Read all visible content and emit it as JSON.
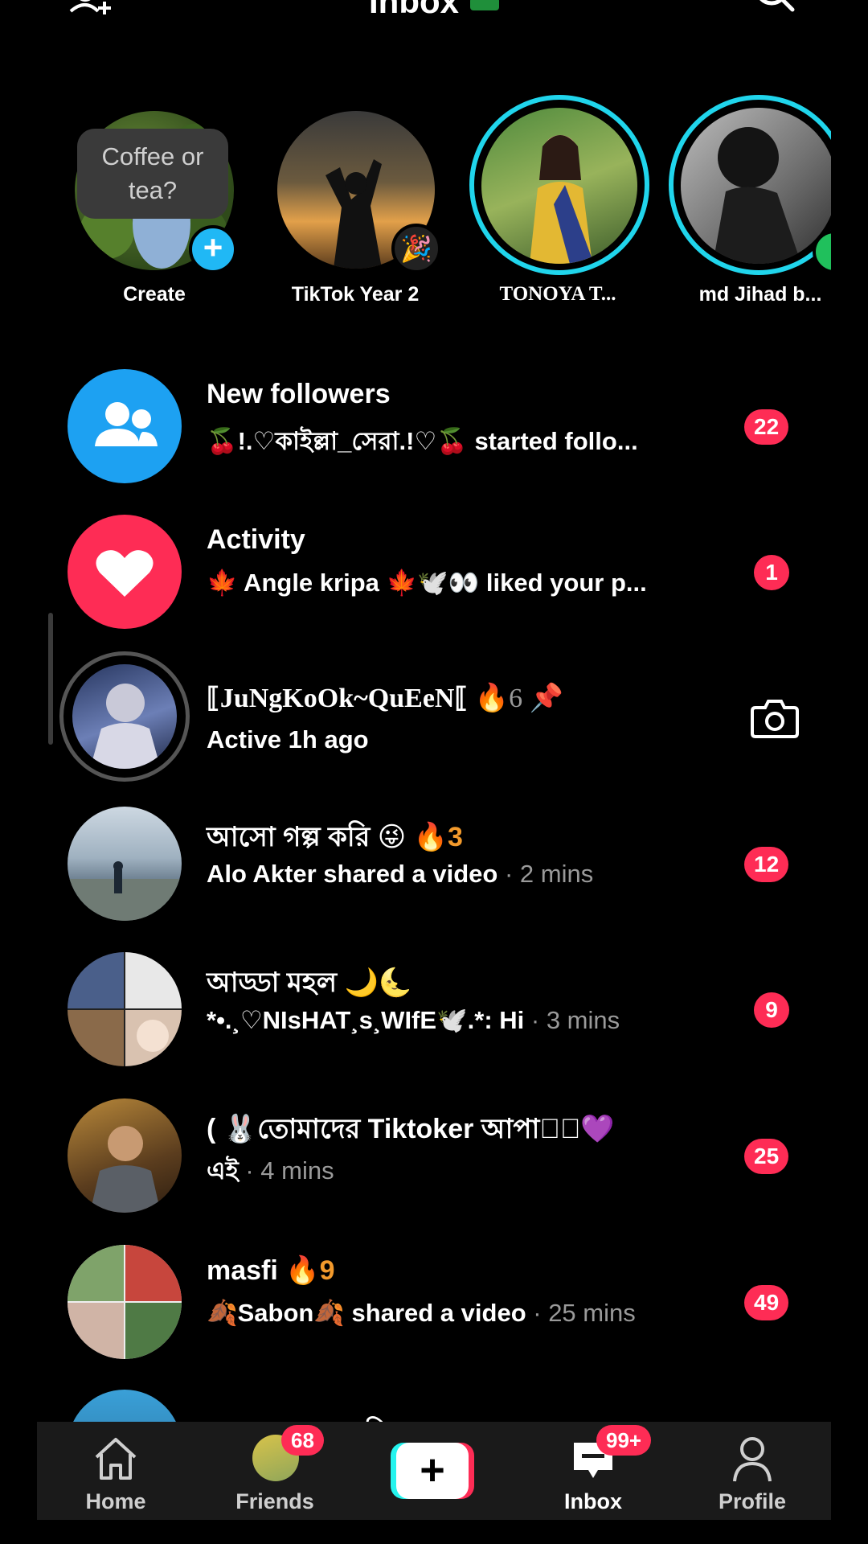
{
  "header": {
    "title": "Inbox"
  },
  "stories": [
    {
      "label": "Create",
      "bubble": "Coffee or tea?"
    },
    {
      "label": "TikTok Year 2"
    },
    {
      "label": "TONOYA T..."
    },
    {
      "label": "md Jihad b..."
    }
  ],
  "rows": [
    {
      "name": "New followers",
      "sub": "🍒!.♡কাইল্লা_সেরা.!♡🍒 started follo...",
      "badge": "22"
    },
    {
      "name": "Activity",
      "sub": "🍁 Angle kripa 🍁🕊️👀 liked your p...",
      "badge": "1"
    },
    {
      "name": "⟦JuNgKoOk~QuEeN⟦",
      "name_extra": "🔥6 📌",
      "sub": "Active 1h ago"
    },
    {
      "name": "আসো গল্প করি 😜",
      "name_extra": "🔥3",
      "sub": "Alo Akter shared a video",
      "time": " · 2 mins",
      "badge": "12"
    },
    {
      "name": "আড্ডা মহল 🌙🌜",
      "sub": "*•.¸♡NIsHAT¸s¸WIfE🕊️.*: Hi",
      "time": " · 3 mins",
      "badge": "9"
    },
    {
      "name": "( 🐰তোমাদের Tiktoker আপা♡ঁ💜",
      "sub": "এই",
      "time": " · 4 mins",
      "badge": "25"
    },
    {
      "name": "masfi",
      "name_extra": "🔥9",
      "sub": "🍂Sabon🍂 shared a video",
      "time": " · 25 mins",
      "badge": "49"
    },
    {
      "name": "ভালোবাসার কবি"
    }
  ],
  "nav": {
    "home": "Home",
    "friends": "Friends",
    "friends_badge": "68",
    "inbox": "Inbox",
    "inbox_badge": "99+",
    "profile": "Profile"
  },
  "colors": {
    "background": "#000000",
    "badge": "#fe2c55",
    "followers_icon_bg": "#1da1f2",
    "activity_icon_bg": "#fe2c55",
    "story_ring": "#20d5ec",
    "online": "#20c05c"
  }
}
